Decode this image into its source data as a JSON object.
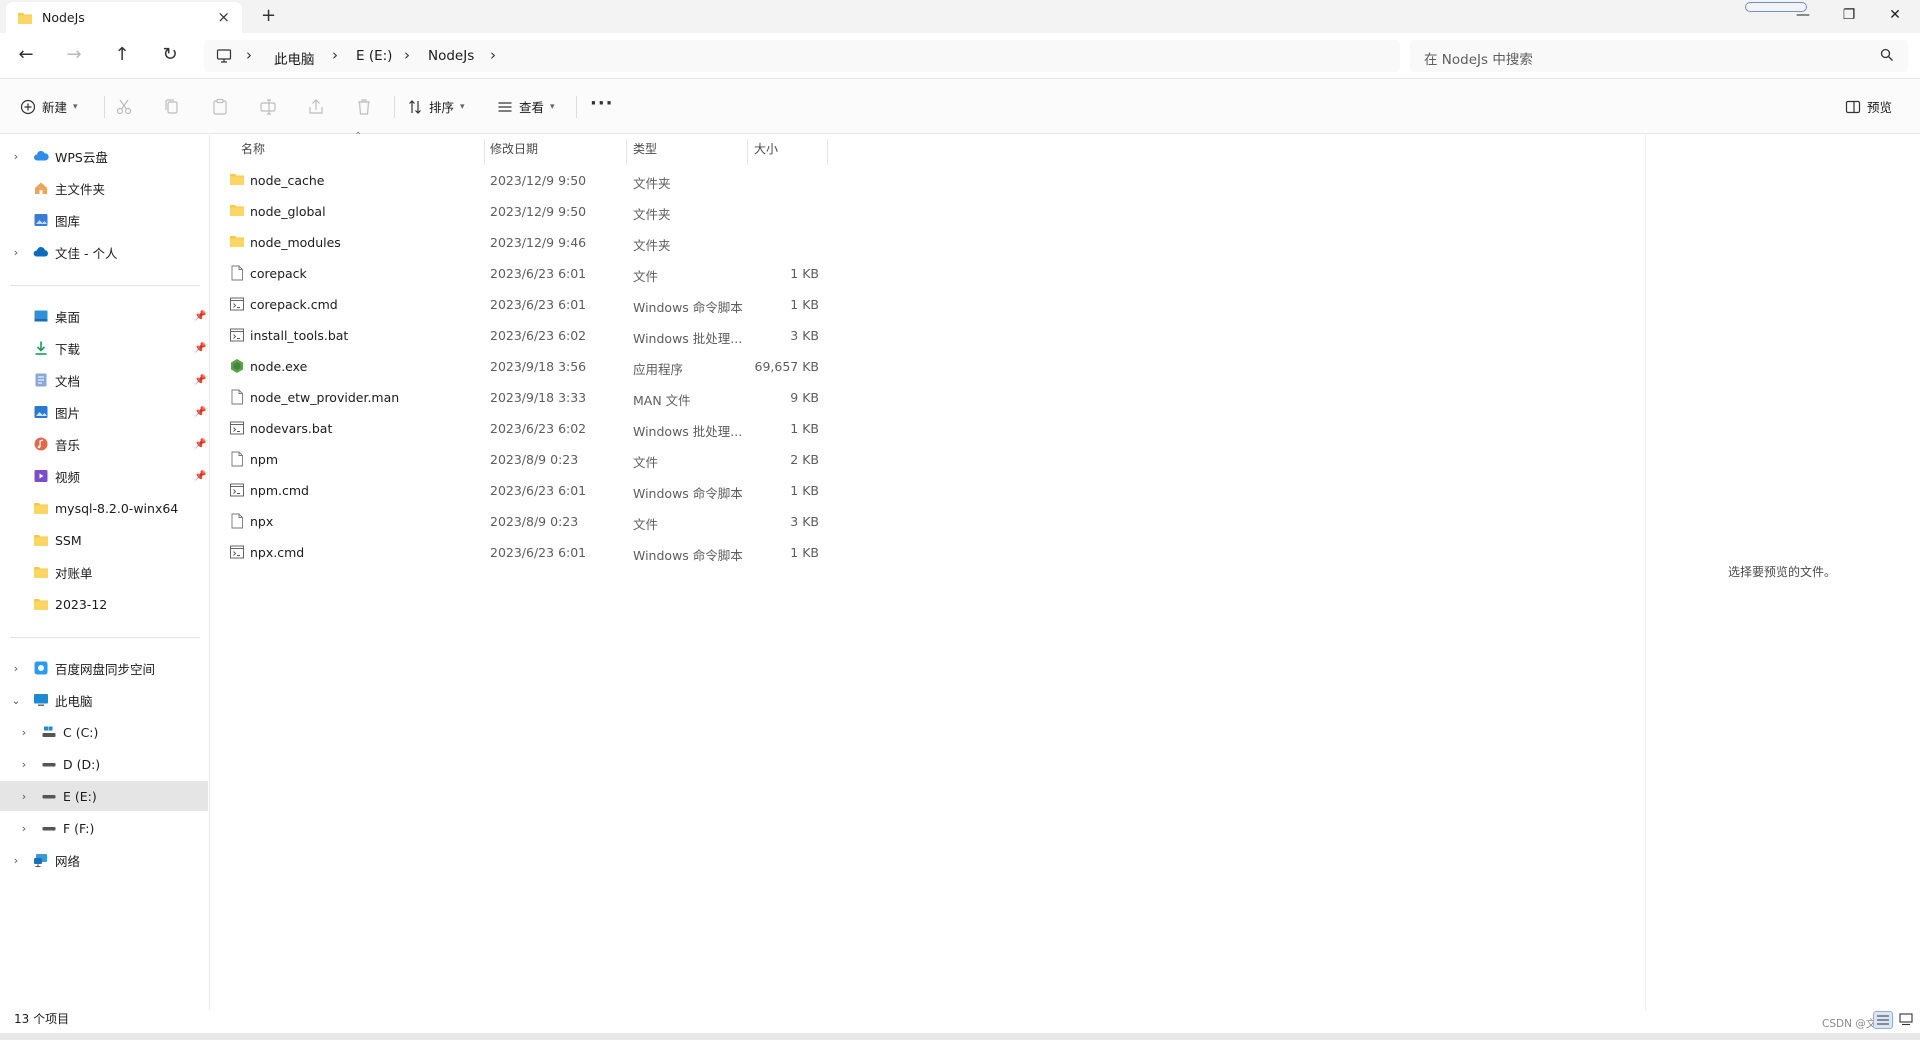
{
  "window": {
    "tab_title": "NodeJs",
    "tab_close": "×",
    "new_tab": "+",
    "minimize": "—",
    "restore": "❐",
    "close": "✕"
  },
  "address": {
    "back": "←",
    "forward": "→",
    "up": "↑",
    "refresh": "↻",
    "crumbs": [
      "此电脑",
      "E (E:)",
      "NodeJs"
    ],
    "search_placeholder": "在 NodeJs 中搜索"
  },
  "toolbar": {
    "new_label": "新建",
    "sort_label": "排序",
    "view_label": "查看",
    "more_label": "···",
    "preview_label": "预览"
  },
  "sidebar": {
    "top_items": [
      {
        "label": "WPS云盘",
        "icon": "wps-cloud-icon"
      },
      {
        "label": "主文件夹",
        "icon": "home-icon"
      },
      {
        "label": "图库",
        "icon": "gallery-icon"
      },
      {
        "label": "文佳 - 个人",
        "icon": "onedrive-cloud-icon"
      }
    ],
    "quick_items": [
      {
        "label": "桌面",
        "icon": "desktop-icon",
        "pinned": true
      },
      {
        "label": "下载",
        "icon": "download-icon",
        "pinned": true
      },
      {
        "label": "文档",
        "icon": "documents-icon",
        "pinned": true
      },
      {
        "label": "图片",
        "icon": "pictures-icon",
        "pinned": true
      },
      {
        "label": "音乐",
        "icon": "music-icon",
        "pinned": true
      },
      {
        "label": "视频",
        "icon": "videos-icon",
        "pinned": true
      },
      {
        "label": "mysql-8.2.0-winx64",
        "icon": "folder-icon",
        "pinned": false
      },
      {
        "label": "SSM",
        "icon": "folder-icon",
        "pinned": false
      },
      {
        "label": "对账单",
        "icon": "folder-icon",
        "pinned": false
      },
      {
        "label": "2023-12",
        "icon": "folder-icon",
        "pinned": false
      }
    ],
    "pc_items": [
      {
        "label": "百度网盘同步空间",
        "icon": "baidu-netdisk-icon"
      },
      {
        "label": "此电脑",
        "icon": "this-pc-icon"
      },
      {
        "label": "C (C:)",
        "icon": "system-drive-icon"
      },
      {
        "label": "D (D:)",
        "icon": "drive-icon"
      },
      {
        "label": "E (E:)",
        "icon": "drive-icon"
      },
      {
        "label": "F (F:)",
        "icon": "drive-icon"
      },
      {
        "label": "网络",
        "icon": "network-icon"
      }
    ]
  },
  "columns": {
    "name": "名称",
    "date": "修改日期",
    "type": "类型",
    "size": "大小"
  },
  "files": [
    {
      "name": "node_cache",
      "date": "2023/12/9 9:50",
      "type": "文件夹",
      "size": "",
      "icon": "folder-icon"
    },
    {
      "name": "node_global",
      "date": "2023/12/9 9:50",
      "type": "文件夹",
      "size": "",
      "icon": "folder-icon"
    },
    {
      "name": "node_modules",
      "date": "2023/12/9 9:46",
      "type": "文件夹",
      "size": "",
      "icon": "folder-icon"
    },
    {
      "name": "corepack",
      "date": "2023/6/23 6:01",
      "type": "文件",
      "size": "1 KB",
      "icon": "file-icon"
    },
    {
      "name": "corepack.cmd",
      "date": "2023/6/23 6:01",
      "type": "Windows 命令脚本",
      "size": "1 KB",
      "icon": "script-icon"
    },
    {
      "name": "install_tools.bat",
      "date": "2023/6/23 6:02",
      "type": "Windows 批处理...",
      "size": "3 KB",
      "icon": "script-icon"
    },
    {
      "name": "node.exe",
      "date": "2023/9/18 3:56",
      "type": "应用程序",
      "size": "69,657 KB",
      "icon": "nodejs-hex-icon"
    },
    {
      "name": "node_etw_provider.man",
      "date": "2023/9/18 3:33",
      "type": "MAN 文件",
      "size": "9 KB",
      "icon": "file-icon"
    },
    {
      "name": "nodevars.bat",
      "date": "2023/6/23 6:02",
      "type": "Windows 批处理...",
      "size": "1 KB",
      "icon": "script-icon"
    },
    {
      "name": "npm",
      "date": "2023/8/9 0:23",
      "type": "文件",
      "size": "2 KB",
      "icon": "file-icon"
    },
    {
      "name": "npm.cmd",
      "date": "2023/6/23 6:01",
      "type": "Windows 命令脚本",
      "size": "1 KB",
      "icon": "script-icon"
    },
    {
      "name": "npx",
      "date": "2023/8/9 0:23",
      "type": "文件",
      "size": "3 KB",
      "icon": "file-icon"
    },
    {
      "name": "npx.cmd",
      "date": "2023/6/23 6:01",
      "type": "Windows 命令脚本",
      "size": "1 KB",
      "icon": "script-icon"
    }
  ],
  "preview_message": "选择要预览的文件。",
  "status": {
    "item_count": "13 个项目",
    "watermark": "CSDN @文佳"
  },
  "colors": {
    "folder": "#f7c948",
    "accent": "#0067c0",
    "selected_bg": "#e5e5e5",
    "node_green": "#5fa04e"
  }
}
